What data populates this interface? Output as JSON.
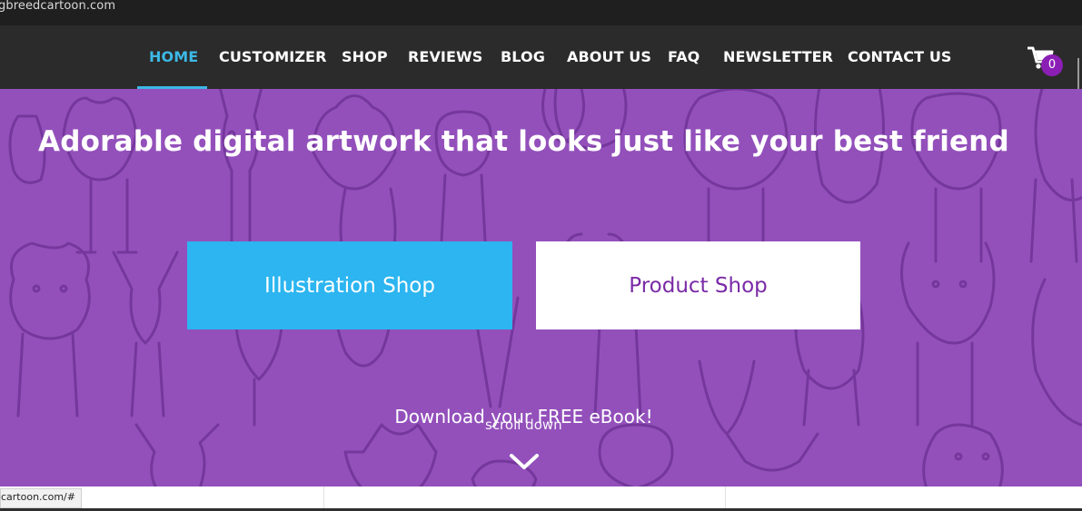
{
  "browser": {
    "url_fragment": "gbreedcartoon.com",
    "status_url": "cartoon.com/#"
  },
  "nav": {
    "items": [
      {
        "label": "HOME",
        "active": true
      },
      {
        "label": "CUSTOMIZER"
      },
      {
        "label": "SHOP"
      },
      {
        "label": "REVIEWS"
      },
      {
        "label": "BLOG"
      },
      {
        "label": "ABOUT US"
      },
      {
        "label": "FAQ"
      },
      {
        "label": "NEWSLETTER"
      },
      {
        "label": "CONTACT US"
      }
    ],
    "cart_count": "0",
    "cart_icon": "shopping-cart-icon"
  },
  "hero": {
    "title": "Adorable digital artwork that looks just like your best friend",
    "buttons": {
      "illustration": "Illustration Shop",
      "product": "Product Shop"
    },
    "ebook_link": "Download your FREE eBook!",
    "scroll_text": "scroll down",
    "scroll_icon": "chevron-down-icon",
    "background_color": "#9350bb",
    "pattern": "dog-cartoon-line-pattern"
  },
  "colors": {
    "accent": "#3cb8e6",
    "nav_bg": "#2b2b2b",
    "illustration_btn": "#2cb5f0",
    "product_text": "#7a2aa6",
    "badge": "#8b1fb5"
  }
}
